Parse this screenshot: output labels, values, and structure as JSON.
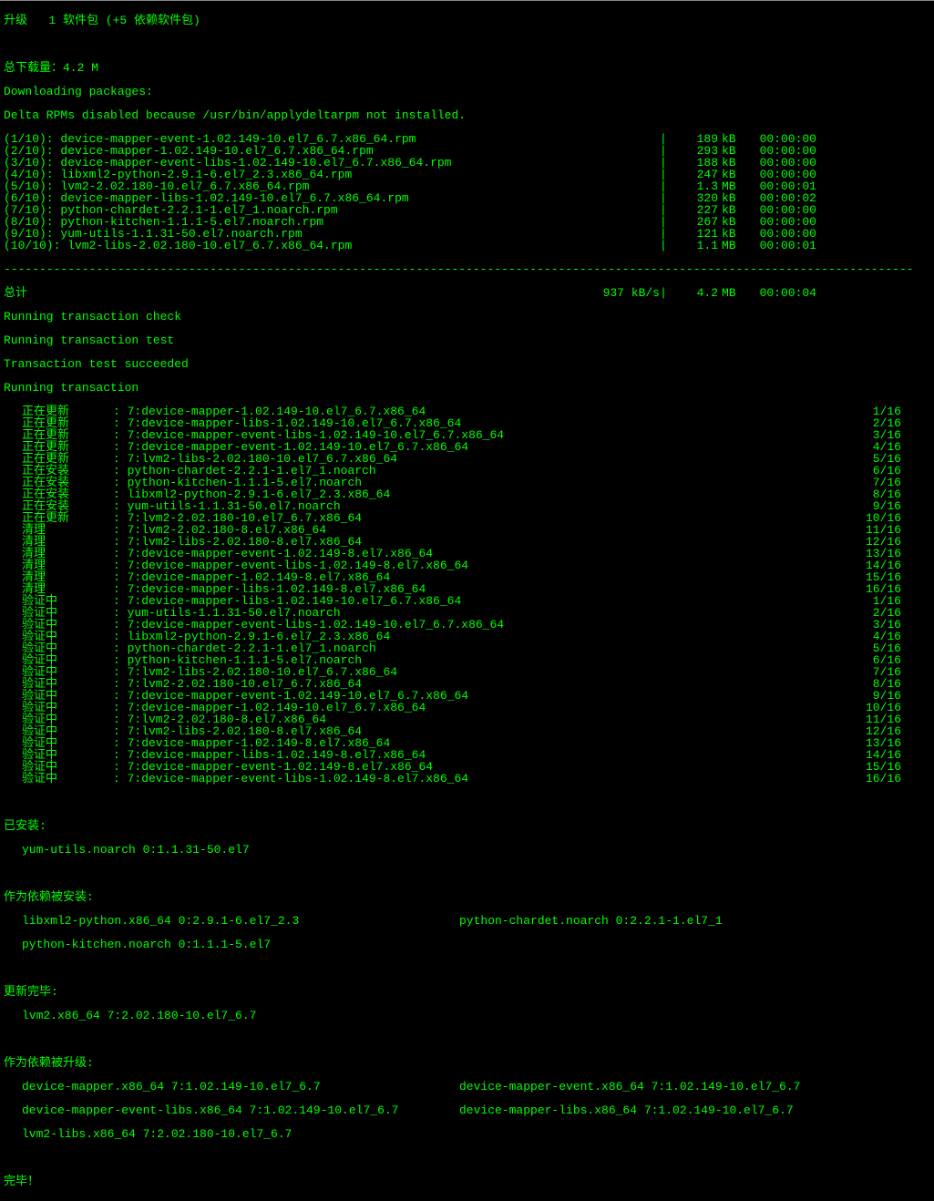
{
  "header": {
    "upgrade": "升级   1 软件包 (+5 依赖软件包)",
    "blank": "",
    "totalDownload": "总下载量：4.2 M",
    "downloading": "Downloading packages:",
    "deltaDisabled": "Delta RPMs disabled because /usr/bin/applydeltarpm not installed."
  },
  "downloads": [
    {
      "pkg": "(1/10): device-mapper-event-1.02.149-10.el7_6.7.x86_64.rpm",
      "size": "189",
      "unit": "kB",
      "time": "00:00:00"
    },
    {
      "pkg": "(2/10): device-mapper-1.02.149-10.el7_6.7.x86_64.rpm",
      "size": "293",
      "unit": "kB",
      "time": "00:00:00"
    },
    {
      "pkg": "(3/10): device-mapper-event-libs-1.02.149-10.el7_6.7.x86_64.rpm",
      "size": "188",
      "unit": "kB",
      "time": "00:00:00"
    },
    {
      "pkg": "(4/10): libxml2-python-2.9.1-6.el7_2.3.x86_64.rpm",
      "size": "247",
      "unit": "kB",
      "time": "00:00:00"
    },
    {
      "pkg": "(5/10): lvm2-2.02.180-10.el7_6.7.x86_64.rpm",
      "size": "1.3",
      "unit": "MB",
      "time": "00:00:01"
    },
    {
      "pkg": "(6/10): device-mapper-libs-1.02.149-10.el7_6.7.x86_64.rpm",
      "size": "320",
      "unit": "kB",
      "time": "00:00:02"
    },
    {
      "pkg": "(7/10): python-chardet-2.2.1-1.el7_1.noarch.rpm",
      "size": "227",
      "unit": "kB",
      "time": "00:00:00"
    },
    {
      "pkg": "(8/10): python-kitchen-1.1.1-5.el7.noarch.rpm",
      "size": "267",
      "unit": "kB",
      "time": "00:00:00"
    },
    {
      "pkg": "(9/10): yum-utils-1.1.31-50.el7.noarch.rpm",
      "size": "121",
      "unit": "kB",
      "time": "00:00:00"
    },
    {
      "pkg": "(10/10): lvm2-libs-2.02.180-10.el7_6.7.x86_64.rpm",
      "size": "1.1",
      "unit": "MB",
      "time": "00:00:01"
    }
  ],
  "hr": "--------------------------------------------------------------------------------------------------------------------------------",
  "total": {
    "label": "总计",
    "speed": "937 kB/s",
    "sep": "|",
    "size": "4.2",
    "unit": "MB",
    "time": "00:00:04"
  },
  "trans": {
    "check": "Running transaction check",
    "test": "Running transaction test",
    "succeeded": "Transaction test succeeded",
    "running": "Running transaction"
  },
  "steps": [
    {
      "label": "正在更新",
      "pkg": ": 7:device-mapper-1.02.149-10.el7_6.7.x86_64",
      "idx": "1/16"
    },
    {
      "label": "正在更新",
      "pkg": ": 7:device-mapper-libs-1.02.149-10.el7_6.7.x86_64",
      "idx": "2/16"
    },
    {
      "label": "正在更新",
      "pkg": ": 7:device-mapper-event-libs-1.02.149-10.el7_6.7.x86_64",
      "idx": "3/16"
    },
    {
      "label": "正在更新",
      "pkg": ": 7:device-mapper-event-1.02.149-10.el7_6.7.x86_64",
      "idx": "4/16"
    },
    {
      "label": "正在更新",
      "pkg": ": 7:lvm2-libs-2.02.180-10.el7_6.7.x86_64",
      "idx": "5/16"
    },
    {
      "label": "正在安装",
      "pkg": ": python-chardet-2.2.1-1.el7_1.noarch",
      "idx": "6/16"
    },
    {
      "label": "正在安装",
      "pkg": ": python-kitchen-1.1.1-5.el7.noarch",
      "idx": "7/16"
    },
    {
      "label": "正在安装",
      "pkg": ": libxml2-python-2.9.1-6.el7_2.3.x86_64",
      "idx": "8/16"
    },
    {
      "label": "正在安装",
      "pkg": ": yum-utils-1.1.31-50.el7.noarch",
      "idx": "9/16"
    },
    {
      "label": "正在更新",
      "pkg": ": 7:lvm2-2.02.180-10.el7_6.7.x86_64",
      "idx": "10/16"
    },
    {
      "label": "清理",
      "pkg": ": 7:lvm2-2.02.180-8.el7.x86_64",
      "idx": "11/16"
    },
    {
      "label": "清理",
      "pkg": ": 7:lvm2-libs-2.02.180-8.el7.x86_64",
      "idx": "12/16"
    },
    {
      "label": "清理",
      "pkg": ": 7:device-mapper-event-1.02.149-8.el7.x86_64",
      "idx": "13/16"
    },
    {
      "label": "清理",
      "pkg": ": 7:device-mapper-event-libs-1.02.149-8.el7.x86_64",
      "idx": "14/16"
    },
    {
      "label": "清理",
      "pkg": ": 7:device-mapper-1.02.149-8.el7.x86_64",
      "idx": "15/16"
    },
    {
      "label": "清理",
      "pkg": ": 7:device-mapper-libs-1.02.149-8.el7.x86_64",
      "idx": "16/16"
    },
    {
      "label": "验证中",
      "pkg": ": 7:device-mapper-libs-1.02.149-10.el7_6.7.x86_64",
      "idx": "1/16"
    },
    {
      "label": "验证中",
      "pkg": ": yum-utils-1.1.31-50.el7.noarch",
      "idx": "2/16"
    },
    {
      "label": "验证中",
      "pkg": ": 7:device-mapper-event-libs-1.02.149-10.el7_6.7.x86_64",
      "idx": "3/16"
    },
    {
      "label": "验证中",
      "pkg": ": libxml2-python-2.9.1-6.el7_2.3.x86_64",
      "idx": "4/16"
    },
    {
      "label": "验证中",
      "pkg": ": python-chardet-2.2.1-1.el7_1.noarch",
      "idx": "5/16"
    },
    {
      "label": "验证中",
      "pkg": ": python-kitchen-1.1.1-5.el7.noarch",
      "idx": "6/16"
    },
    {
      "label": "验证中",
      "pkg": ": 7:lvm2-libs-2.02.180-10.el7_6.7.x86_64",
      "idx": "7/16"
    },
    {
      "label": "验证中",
      "pkg": ": 7:lvm2-2.02.180-10.el7_6.7.x86_64",
      "idx": "8/16"
    },
    {
      "label": "验证中",
      "pkg": ": 7:device-mapper-event-1.02.149-10.el7_6.7.x86_64",
      "idx": "9/16"
    },
    {
      "label": "验证中",
      "pkg": ": 7:device-mapper-1.02.149-10.el7_6.7.x86_64",
      "idx": "10/16"
    },
    {
      "label": "验证中",
      "pkg": ": 7:lvm2-2.02.180-8.el7.x86_64",
      "idx": "11/16"
    },
    {
      "label": "验证中",
      "pkg": ": 7:lvm2-libs-2.02.180-8.el7.x86_64",
      "idx": "12/16"
    },
    {
      "label": "验证中",
      "pkg": ": 7:device-mapper-1.02.149-8.el7.x86_64",
      "idx": "13/16"
    },
    {
      "label": "验证中",
      "pkg": ": 7:device-mapper-libs-1.02.149-8.el7.x86_64",
      "idx": "14/16"
    },
    {
      "label": "验证中",
      "pkg": ": 7:device-mapper-event-1.02.149-8.el7.x86_64",
      "idx": "15/16"
    },
    {
      "label": "验证中",
      "pkg": ": 7:device-mapper-event-libs-1.02.149-8.el7.x86_64",
      "idx": "16/16"
    }
  ],
  "installed": {
    "header": "已安装:",
    "pkg": "yum-utils.noarch 0:1.1.31-50.el7"
  },
  "depsInstalled": {
    "header": "作为依赖被安装:",
    "col1": "libxml2-python.x86_64 0:2.9.1-6.el7_2.3",
    "col2": "python-chardet.noarch 0:2.2.1-1.el7_1",
    "col3": "python-kitchen.noarch 0:1.1.1-5.el7"
  },
  "updated": {
    "header": "更新完毕:",
    "pkg": "lvm2.x86_64 7:2.02.180-10.el7_6.7"
  },
  "depsUpgraded": {
    "header": "作为依赖被升级:",
    "r1c1": "device-mapper.x86_64 7:1.02.149-10.el7_6.7",
    "r1c2": "device-mapper-event.x86_64 7:1.02.149-10.el7_6.7",
    "r2c1": "device-mapper-event-libs.x86_64 7:1.02.149-10.el7_6.7",
    "r2c2": "device-mapper-libs.x86_64 7:1.02.149-10.el7_6.7",
    "r3c1": "lvm2-libs.x86_64 7:2.02.180-10.el7_6.7"
  },
  "done": "完毕！"
}
